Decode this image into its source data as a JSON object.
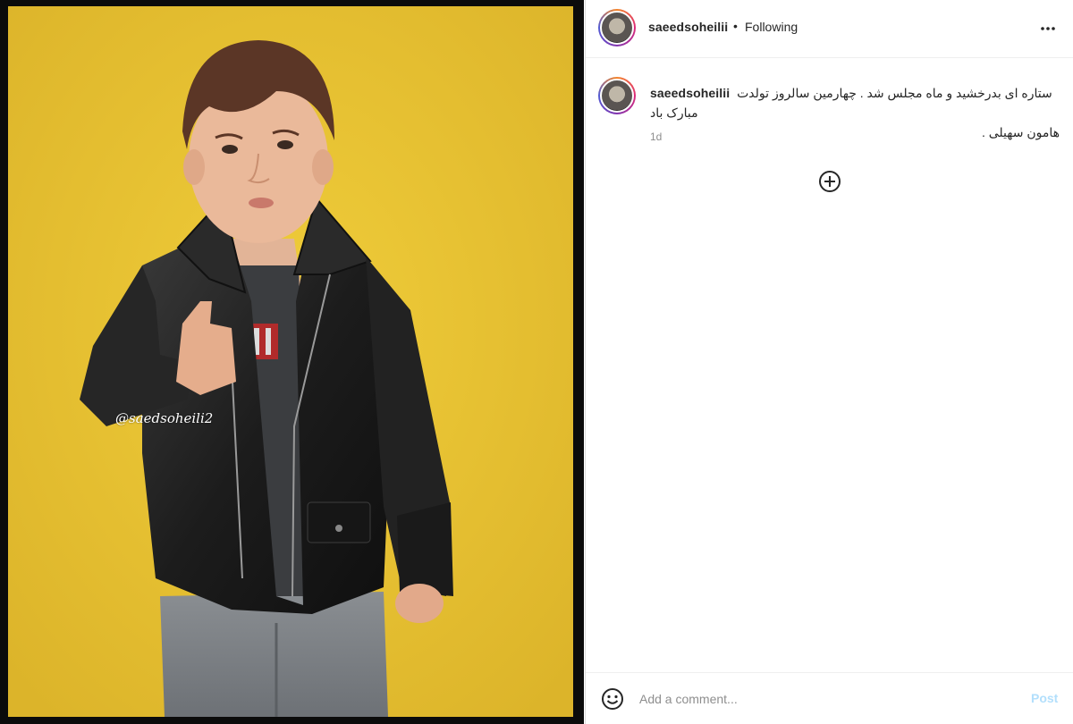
{
  "photo": {
    "watermark": "@saedsoheili2",
    "background_color": "#e6c12f"
  },
  "header": {
    "username": "saeedsoheilii",
    "separator": "•",
    "follow_status": "Following",
    "more_icon": "more-horizontal-icon"
  },
  "caption": {
    "username": "saeedsoheilii",
    "line1": "ستاره ای بدرخشید و ماه مجلس شد . چهارمین سالروز تولدت مبارک باد",
    "line2": "هامون سهیلی .",
    "timestamp": "1d"
  },
  "load_more": {
    "icon": "plus-circle-icon"
  },
  "comment_bar": {
    "emoji_icon": "smiley-icon",
    "placeholder": "Add a comment...",
    "post_label": "Post",
    "post_color": "#b2dffc"
  }
}
